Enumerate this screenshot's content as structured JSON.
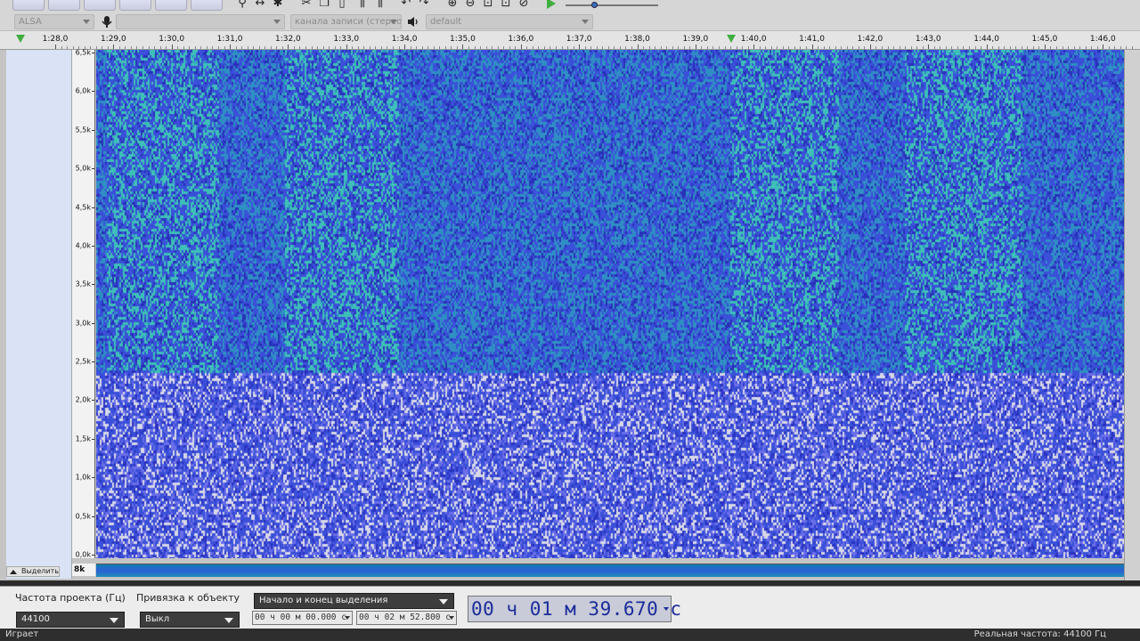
{
  "toolbar": {
    "tools": [
      "zoom-icon",
      "timeshift-icon",
      "multi-tool-icon",
      "cut-icon",
      "copy-icon",
      "paste-icon",
      "trim-icon",
      "silence-icon",
      "undo-icon",
      "redo-icon",
      "zoom-in-icon",
      "zoom-out-icon",
      "fit-selection-icon",
      "fit-project-icon",
      "zoom-toggle-icon",
      "play-at-speed-icon"
    ],
    "colors": {
      "play": "#3fae3f"
    }
  },
  "devices": {
    "host": "ALSA",
    "recording_device": "",
    "channels": "канала записи (стерео)",
    "playback_device": "default"
  },
  "ruler": {
    "labels": [
      "1:28,0",
      "1:29,0",
      "1:30,0",
      "1:31,0",
      "1:32,0",
      "1:33,0",
      "1:34,0",
      "1:35,0",
      "1:36,0",
      "1:37,0",
      "1:38,0",
      "1:39,0",
      "1:40,0",
      "1:41,0",
      "1:42,0",
      "1:43,0",
      "1:44,0",
      "1:45,0",
      "1:46,0"
    ],
    "marker_color": "#3fae3f"
  },
  "track": {
    "select_button": "Выделить",
    "freq_labels": [
      "6,5k",
      "6,0k",
      "5,5k",
      "5,0k",
      "4,5k",
      "4,0k",
      "3,5k",
      "3,0k",
      "2,5k",
      "2,0k",
      "1,5k",
      "1,0k",
      "0,5k",
      "0,0k"
    ],
    "mini_label": "8k",
    "spectrogram_colors": {
      "base": "#3a50d8",
      "mid": "#2f8fc4",
      "high": "#3ec0b8",
      "peak": "#d8d8e8"
    }
  },
  "selection_bar": {
    "project_rate_label": "Частота проекта (Гц)",
    "project_rate_value": "44100",
    "snap_label": "Привязка к объекту",
    "snap_value": "Выкл",
    "selection_mode": "Начало и конец выделения",
    "start_time": "00 ч 00 м 00.000 с",
    "end_time": "00 ч 02 м 52.800 с",
    "audio_position": "00 ч 01 м 39.670 с"
  },
  "status": {
    "state": "Играет",
    "actual_rate": "Реальная частота: 44100 Гц"
  }
}
